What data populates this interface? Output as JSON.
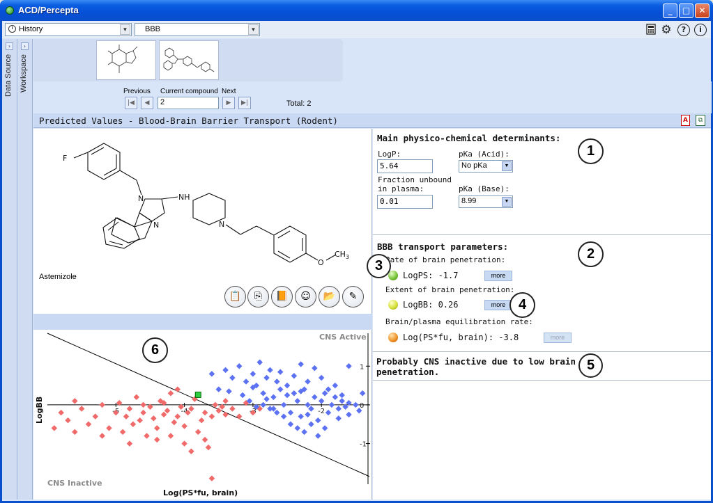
{
  "window": {
    "title": "ACD/Percepta",
    "buttons": {
      "minimize": "_",
      "maximize": "□",
      "close": "✕"
    }
  },
  "toolbar": {
    "history_label": "History",
    "module_label": "BBB",
    "icons": [
      "calculator-icon",
      "gear-icon",
      "help-icon",
      "info-icon"
    ]
  },
  "side_tabs": {
    "data_source": "Data Source",
    "workspace": "Workspace"
  },
  "navigation": {
    "previous_label": "Previous",
    "current_label": "Current compound",
    "next_label": "Next",
    "current_value": "2",
    "total_text": "Total: 2"
  },
  "section": {
    "title": "Predicted Values - Blood-Brain Barrier Transport (Rodent)"
  },
  "compound": {
    "name": "Astemizole"
  },
  "structure_labels": {
    "f": "F",
    "n1": "N",
    "n2": "N",
    "nh": "NH",
    "n3": "N",
    "o": "O",
    "ch3": "CH",
    "sub3": "3"
  },
  "action_buttons": [
    "paste-structure-icon",
    "copy-structure-icon",
    "book-icon",
    "smiley-icon",
    "open-folder-icon",
    "edit-pencil-icon"
  ],
  "physchem": {
    "heading": "Main physico-chemical determinants:",
    "logp_label": "LogP:",
    "logp_value": "5.64",
    "pka_acid_label": "pKa (Acid):",
    "pka_acid_value": "No pKa",
    "fu_label_1": "Fraction unbound",
    "fu_label_2": "in plasma:",
    "fu_value": "0.01",
    "pka_base_label": "pKa (Base):",
    "pka_base_value": "8.99"
  },
  "bbb": {
    "heading": "BBB transport parameters:",
    "rate_label": "Rate of brain penetration:",
    "logps_text": "LogPS: -1.7",
    "extent_label": "Extent of brain penetration:",
    "logbb_text": "LogBB: 0.26",
    "equil_label": "Brain/plasma equilibration rate:",
    "logpsfu_text": "Log(PS*fu, brain): -3.8",
    "more_label": "more"
  },
  "conclusion": {
    "line1": "Probably CNS inactive due to low brain",
    "line2": "penetration."
  },
  "callouts": [
    "1",
    "2",
    "3",
    "4",
    "5",
    "6"
  ],
  "chart_data": {
    "type": "scatter",
    "xlabel": "Log(PS*fu, brain)",
    "ylabel": "LogBB",
    "xlim": [
      -6.0,
      -1.3
    ],
    "ylim": [
      -2.05,
      1.85
    ],
    "xticks": [
      {
        "v": -5,
        "label": "-5"
      },
      {
        "v": -4,
        "label": "-4"
      },
      {
        "v": -3,
        "label": "-3"
      },
      {
        "v": -2,
        "label": "-2"
      }
    ],
    "yticks": [
      {
        "v": 1,
        "label": "1"
      },
      {
        "v": 0,
        "label": "0"
      },
      {
        "v": -1,
        "label": "-1"
      }
    ],
    "region_labels": {
      "active": "CNS Active",
      "inactive": "CNS Inactive"
    },
    "boundary": [
      [
        -6.0,
        1.85
      ],
      [
        -1.3,
        -1.85
      ]
    ],
    "current_compound": {
      "x": -3.8,
      "y": 0.26
    },
    "series": [
      {
        "name": "CNS inactive",
        "color": "#f06a6a",
        "points": [
          [
            -5.8,
            -0.2
          ],
          [
            -5.7,
            -0.4
          ],
          [
            -5.6,
            0.1
          ],
          [
            -5.5,
            -0.1
          ],
          [
            -5.4,
            -0.5
          ],
          [
            -5.3,
            -0.3
          ],
          [
            -5.2,
            0.0
          ],
          [
            -5.1,
            -0.6
          ],
          [
            -5.0,
            -0.2
          ],
          [
            -4.95,
            0.05
          ],
          [
            -4.9,
            -0.7
          ],
          [
            -4.85,
            -0.3
          ],
          [
            -4.8,
            -0.1
          ],
          [
            -4.75,
            -0.5
          ],
          [
            -4.7,
            0.2
          ],
          [
            -4.65,
            -0.4
          ],
          [
            -4.6,
            -0.2
          ],
          [
            -4.55,
            -0.8
          ],
          [
            -4.5,
            -0.05
          ],
          [
            -4.45,
            -0.35
          ],
          [
            -4.4,
            -0.6
          ],
          [
            -4.35,
            0.1
          ],
          [
            -4.3,
            -0.25
          ],
          [
            -4.25,
            -0.15
          ],
          [
            -4.2,
            0.3
          ],
          [
            -4.15,
            -0.45
          ],
          [
            -4.1,
            -0.3
          ],
          [
            -4.05,
            -0.05
          ],
          [
            -4.0,
            -0.55
          ],
          [
            -3.95,
            -0.2
          ],
          [
            -3.9,
            -0.1
          ],
          [
            -3.85,
            0.15
          ],
          [
            -3.8,
            -0.7
          ],
          [
            -3.75,
            -0.4
          ],
          [
            -3.7,
            -0.2
          ],
          [
            -3.65,
            -1.1
          ],
          [
            -3.6,
            -0.3
          ],
          [
            -3.55,
            0.0
          ],
          [
            -3.5,
            -0.15
          ],
          [
            -3.45,
            -0.05
          ],
          [
            -3.4,
            -0.25
          ],
          [
            -3.3,
            -0.1
          ],
          [
            -3.2,
            -0.3
          ],
          [
            -3.1,
            0.05
          ],
          [
            -3.0,
            -0.2
          ],
          [
            -2.9,
            -0.1
          ],
          [
            -4.4,
            -0.9
          ],
          [
            -4.2,
            -0.8
          ],
          [
            -4.0,
            -1.0
          ],
          [
            -3.9,
            -1.2
          ],
          [
            -3.7,
            -0.9
          ],
          [
            -4.8,
            -1.0
          ],
          [
            -5.2,
            -0.8
          ],
          [
            -5.6,
            -0.7
          ],
          [
            -5.9,
            -0.6
          ],
          [
            -4.6,
            0.0
          ],
          [
            -4.3,
            0.05
          ],
          [
            -3.6,
            -1.9
          ],
          [
            -4.1,
            0.4
          ],
          [
            -3.4,
            0.1
          ]
        ]
      },
      {
        "name": "CNS active",
        "color": "#5c72f2",
        "points": [
          [
            -3.4,
            0.9
          ],
          [
            -3.3,
            0.7
          ],
          [
            -3.2,
            1.0
          ],
          [
            -3.1,
            0.6
          ],
          [
            -3.0,
            0.8
          ],
          [
            -2.95,
            0.5
          ],
          [
            -2.9,
            1.1
          ],
          [
            -2.85,
            0.3
          ],
          [
            -2.8,
            0.7
          ],
          [
            -2.75,
            0.9
          ],
          [
            -2.7,
            0.2
          ],
          [
            -2.65,
            0.6
          ],
          [
            -2.6,
            0.4
          ],
          [
            -2.55,
            0.0
          ],
          [
            -2.5,
            0.5
          ],
          [
            -2.45,
            -0.2
          ],
          [
            -2.4,
            0.3
          ],
          [
            -2.35,
            0.1
          ],
          [
            -2.3,
            -0.3
          ],
          [
            -2.25,
            0.4
          ],
          [
            -2.2,
            0.0
          ],
          [
            -2.15,
            -0.1
          ],
          [
            -2.1,
            0.2
          ],
          [
            -2.05,
            -0.4
          ],
          [
            -2.0,
            0.1
          ],
          [
            -1.95,
            0.3
          ],
          [
            -1.9,
            -0.2
          ],
          [
            -1.85,
            0.0
          ],
          [
            -1.8,
            0.2
          ],
          [
            -1.75,
            -0.1
          ],
          [
            -1.7,
            0.1
          ],
          [
            -1.65,
            -0.05
          ],
          [
            -1.6,
            0.05
          ],
          [
            -3.5,
            0.4
          ],
          [
            -3.6,
            0.8
          ],
          [
            -3.35,
            0.35
          ],
          [
            -3.15,
            0.25
          ],
          [
            -3.05,
            0.1
          ],
          [
            -2.95,
            -0.05
          ],
          [
            -2.85,
            0.0
          ],
          [
            -2.75,
            -0.1
          ],
          [
            -2.65,
            -0.2
          ],
          [
            -2.55,
            -0.3
          ],
          [
            -2.45,
            -0.5
          ],
          [
            -2.35,
            -0.6
          ],
          [
            -2.25,
            -0.7
          ],
          [
            -2.15,
            -0.5
          ],
          [
            -2.05,
            -0.8
          ],
          [
            -1.95,
            -0.6
          ],
          [
            -2.6,
            0.85
          ],
          [
            -2.4,
            0.75
          ],
          [
            -2.2,
            0.6
          ],
          [
            -2.0,
            0.7
          ],
          [
            -1.8,
            0.5
          ],
          [
            -1.6,
            1.0
          ],
          [
            -1.5,
            0.0
          ],
          [
            -1.4,
            0.3
          ],
          [
            -2.3,
            1.05
          ],
          [
            -2.1,
            0.95
          ],
          [
            -3.0,
            0.45
          ],
          [
            -2.8,
            0.15
          ],
          [
            -2.5,
            0.25
          ],
          [
            -2.3,
            0.35
          ],
          [
            -1.9,
            0.4
          ],
          [
            -1.7,
            0.25
          ],
          [
            -1.45,
            -0.15
          ],
          [
            -2.7,
            -0.1
          ],
          [
            -2.2,
            -0.25
          ],
          [
            -1.75,
            -0.35
          ],
          [
            -1.6,
            -0.25
          ]
        ]
      }
    ]
  }
}
